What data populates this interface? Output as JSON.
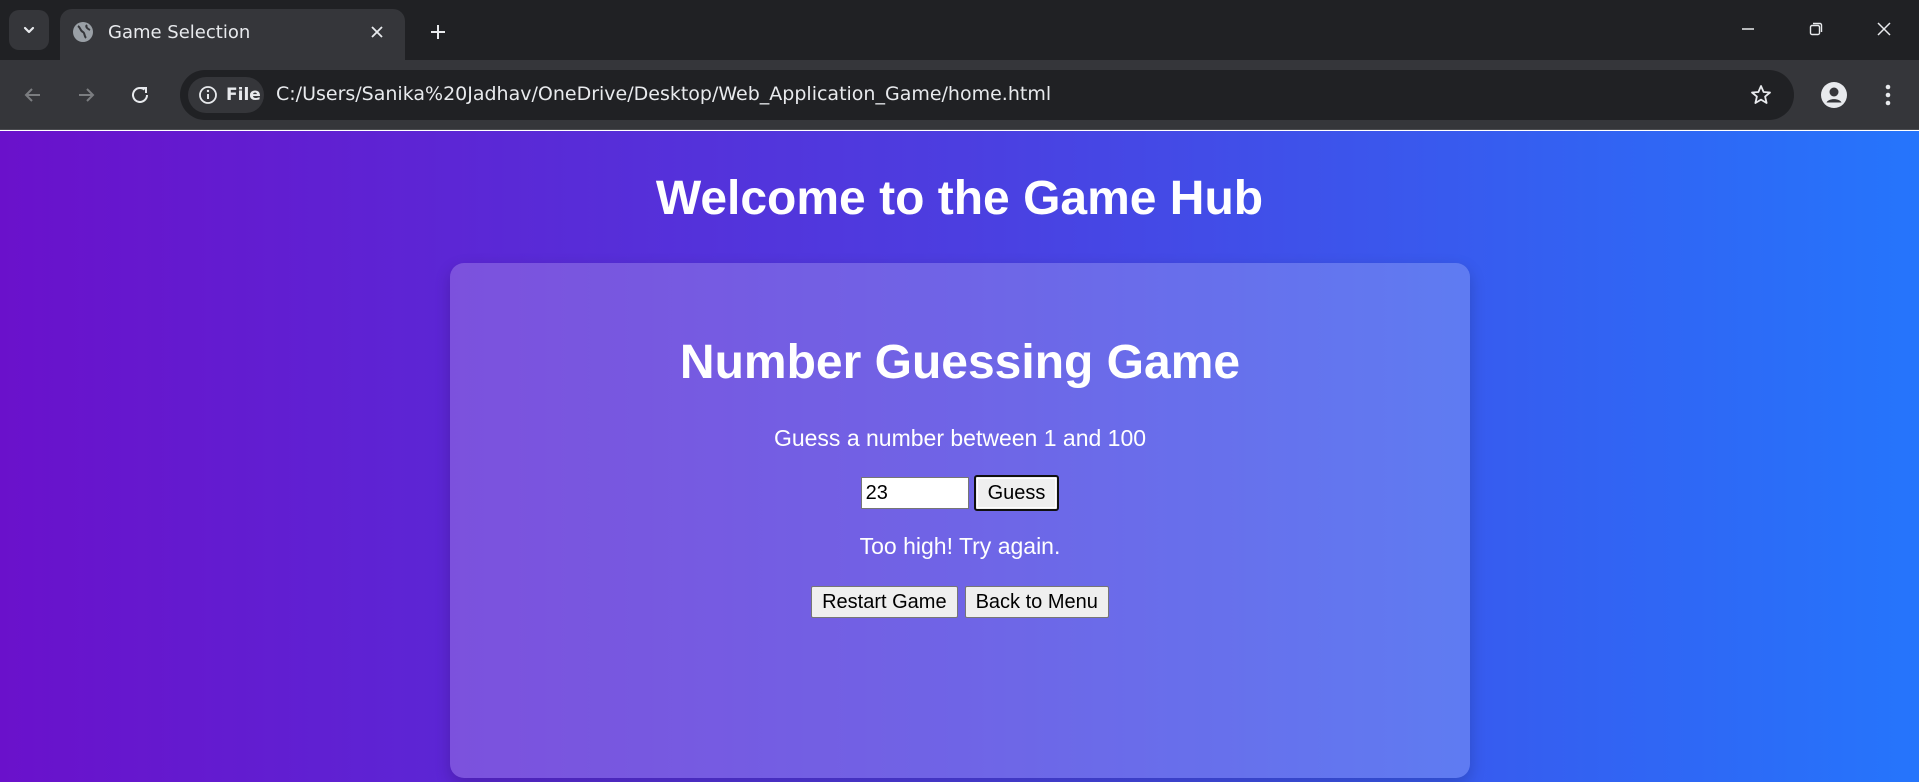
{
  "browser": {
    "tab_title": "Game Selection",
    "chip_label": "File",
    "url": "C:/Users/Sanika%20Jadhav/OneDrive/Desktop/Web_Application_Game/home.html",
    "icons": [
      "tab-list-chevron-icon",
      "globe-icon",
      "close-icon",
      "plus-icon",
      "minimize-icon",
      "restore-icon",
      "window-close-icon",
      "back-icon",
      "forward-icon",
      "reload-icon",
      "info-icon",
      "star-icon",
      "profile-icon",
      "kebab-menu-icon"
    ]
  },
  "page": {
    "hub_title": "Welcome to the Game Hub",
    "game": {
      "title": "Number Guessing Game",
      "instructions": "Guess a number between 1 and 100",
      "guess_value": "23",
      "guess_button": "Guess",
      "feedback": "Too high! Try again.",
      "restart_button": "Restart Game",
      "menu_button": "Back to Menu"
    }
  },
  "colors": {
    "chrome_dark": "#202124",
    "chrome_toolbar": "#35363a",
    "gradient_start": "#6a11cb",
    "gradient_end": "#2575fc",
    "text_white": "#ffffff"
  }
}
